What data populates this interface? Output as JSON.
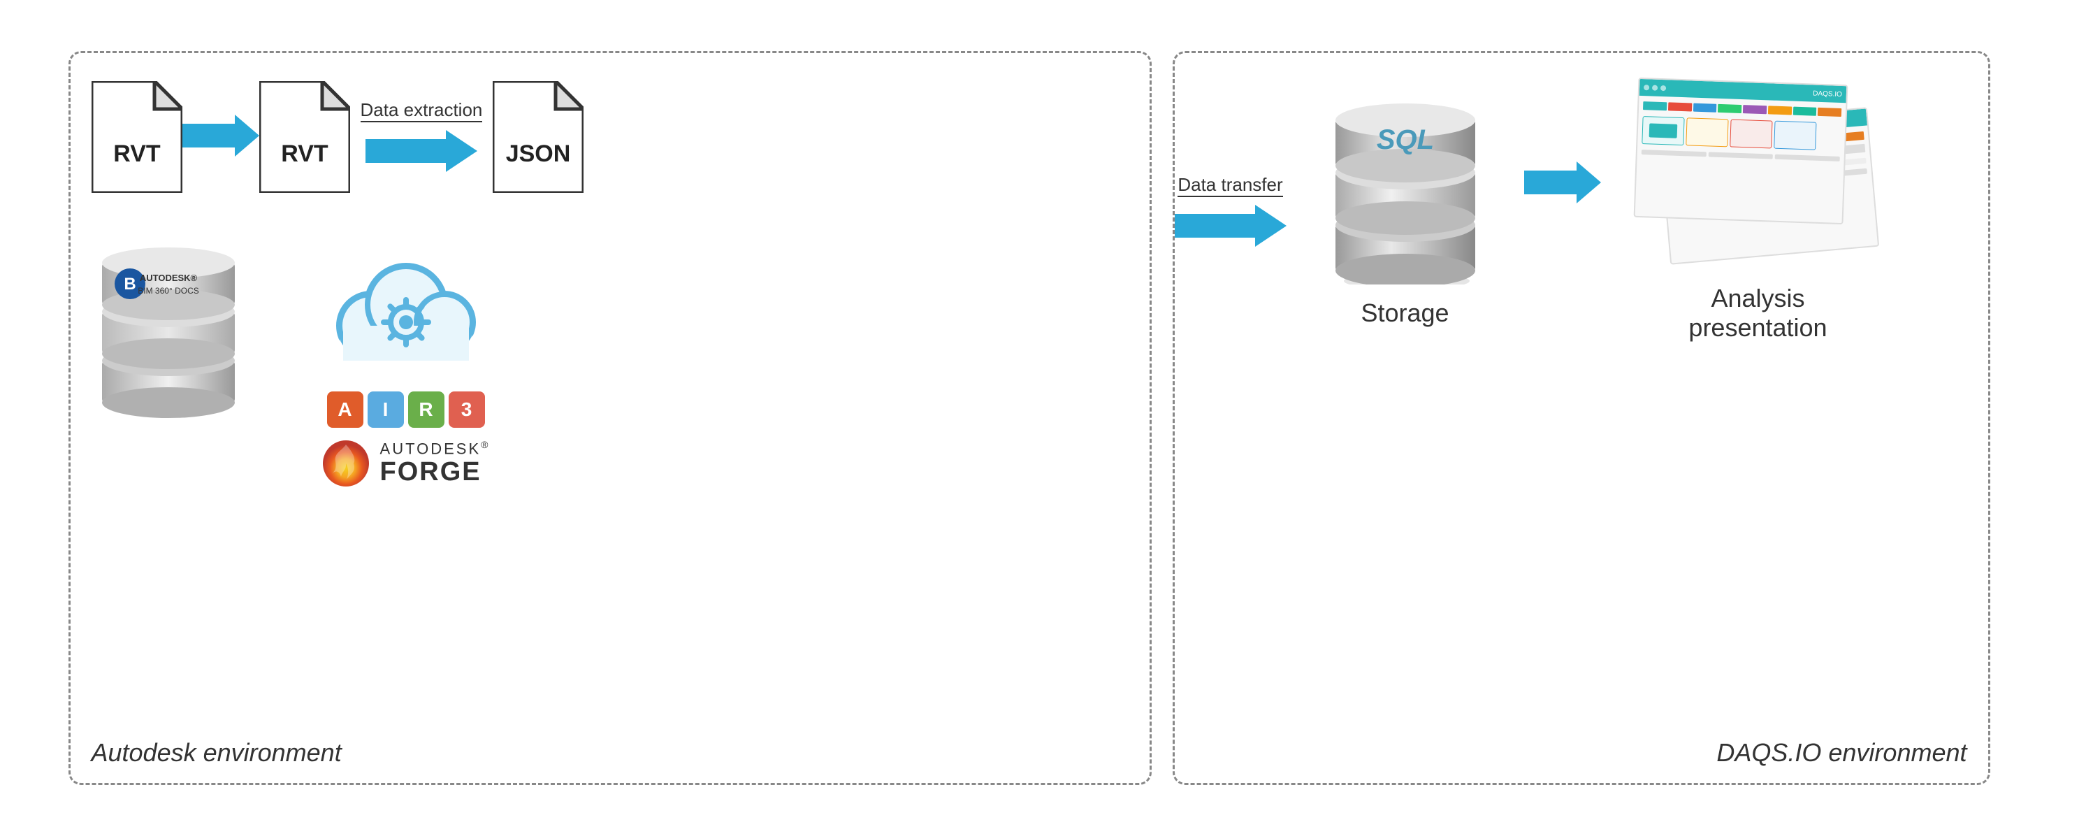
{
  "diagram": {
    "left_env_label": "Autodesk environment",
    "right_env_label": "DAQS.IO environment",
    "data_extraction_label": "Data extraction",
    "data_transfer_label": "Data transfer",
    "storage_label": "Storage",
    "analysis_label": "Analysis\npresentation",
    "file1_label": "RVT",
    "file2_label": "RVT",
    "file3_label": "JSON",
    "sql_label": "SQL",
    "autodesk_text": "AUTODESK",
    "registered_mark": "®",
    "forge_text": "FORGE",
    "bim360_line1": "AUTODESK",
    "bim360_line2": "BIM 360° DOCS",
    "air_blocks": [
      "A",
      "I",
      "R",
      "3"
    ],
    "air_colors": [
      "#e05c2a",
      "#5aabe0",
      "#6aaf4a",
      "#e06050"
    ]
  }
}
